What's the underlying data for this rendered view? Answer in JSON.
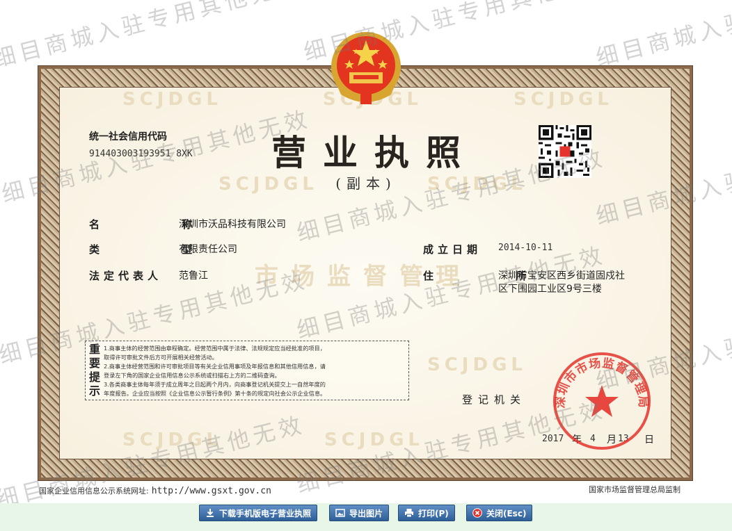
{
  "license": {
    "title": "营业执照",
    "subtitle": "(副本)",
    "credit_code_label": "统一社会信用代码",
    "credit_code_value": "914403003193951 8XK",
    "name_label": "名          称",
    "name_value": "深圳市沃品科技有限公司",
    "type_label": "类          型",
    "type_value": "有限责任公司",
    "legal_rep_label": "法定代表人",
    "legal_rep_value": "范鲁江",
    "established_label": "成立日期",
    "established_value": "2014-10-11",
    "address_label": "住          所",
    "address_line1": "深圳市宝安区西乡街道固戍社",
    "address_line2": "区下围园工业区9号三楼",
    "notice_tag": "重要提示",
    "notice_lines": [
      "1.商事主体的经营范围由章程确定。经营范围中属于法律、法规规定应当经批准的项目，",
      "取得许可审批文件后方可开展相关经营活动。",
      "2.商事主体经营范围和许可审批项目等有关企业信用事项及年报信息和其他信用信息，请",
      "登录左下角的国家企业信用信息公示系统或扫描右上方的二维码查询。",
      "3.各类商事主体每年须于成立周年之日起两个月内，向商事登记机关提交上一自然年度的",
      "年度报告。企业应当按照《企业信息公示暂行条例》第十条的规定向社会公示企业信息。"
    ],
    "issuer_label": "登记机关",
    "issue_year": "2017",
    "issue_year_unit": "年",
    "issue_month": "4",
    "issue_month_unit": "月",
    "issue_day": "13",
    "issue_day_unit": "日",
    "seal_text": "深圳市市场监督管理局",
    "background_mark": "SCJDGL",
    "background_mark_2": "市场监督管理",
    "footer_left_label": "国家企业信用信息公示系统网址:",
    "footer_left_url": "http://www.gsxt.gov.cn",
    "footer_right": "国家市场监督管理总局监制"
  },
  "watermark_text": "细目商城入驻专用其他无效",
  "toolbar": {
    "download_label": "下载手机版电子营业执照",
    "export_label": "导出图片",
    "print_label": "打印(P)",
    "close_label": "关闭(Esc)"
  },
  "colors": {
    "frame_brown": "#8a6a4a",
    "seal_red": "#e5342c",
    "button_blue": "#2f5f98",
    "toolbar_bg": "#e7f6e7"
  },
  "icons": [
    "national-emblem-icon",
    "qr-code-icon",
    "download-icon",
    "image-icon",
    "printer-icon",
    "close-icon"
  ]
}
